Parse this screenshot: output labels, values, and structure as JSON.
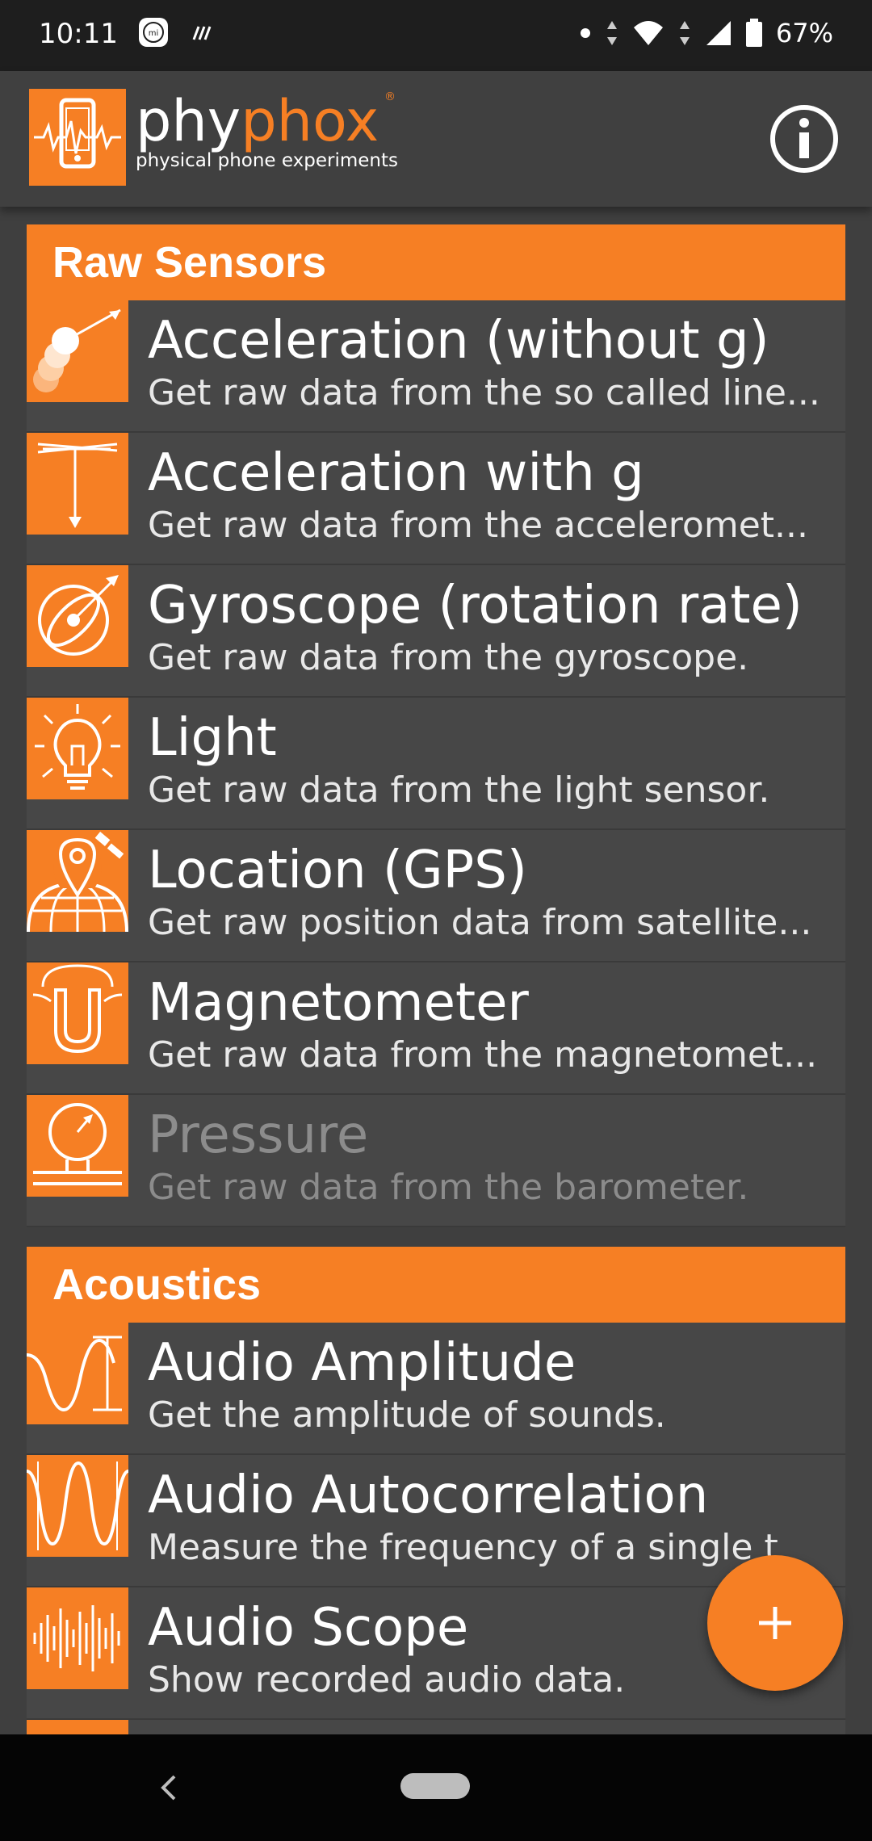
{
  "status_bar": {
    "time": "10:11",
    "battery_percent": "67%",
    "icons": [
      "mi-notification-icon",
      "signal-notification-icon",
      "dot-icon",
      "data-arrows-icon",
      "wifi-icon",
      "cell-signal-icon",
      "battery-icon"
    ]
  },
  "app_bar": {
    "brand_phy": "phy",
    "brand_phox": "phox",
    "brand_registered": "®",
    "tagline": "physical phone experiments",
    "info_icon": "info-icon"
  },
  "categories": [
    {
      "title": "Raw Sensors",
      "items": [
        {
          "title": "Acceleration (without g)",
          "desc": "Get raw data from the so called line...",
          "icon": "linear-acceleration-icon"
        },
        {
          "title": "Acceleration with g",
          "desc": "Get raw data from the acceleromet...",
          "icon": "acceleration-g-icon"
        },
        {
          "title": "Gyroscope (rotation rate)",
          "desc": "Get raw data from the gyroscope.",
          "icon": "gyroscope-icon"
        },
        {
          "title": "Light",
          "desc": "Get raw data from the light sensor.",
          "icon": "light-bulb-icon"
        },
        {
          "title": "Location (GPS)",
          "desc": "Get raw position data from satellite...",
          "icon": "gps-location-icon"
        },
        {
          "title": "Magnetometer",
          "desc": "Get raw data from the magnetomet...",
          "icon": "magnet-icon"
        },
        {
          "title": "Pressure",
          "desc": "Get raw data from the barometer.",
          "icon": "barometer-icon",
          "disabled": true
        }
      ]
    },
    {
      "title": "Acoustics",
      "items": [
        {
          "title": "Audio Amplitude",
          "desc": "Get the amplitude of sounds.",
          "icon": "audio-amplitude-icon"
        },
        {
          "title": "Audio Autocorrelation",
          "desc": "Measure the frequency of a single t",
          "icon": "audio-autocorrelation-icon"
        },
        {
          "title": "Audio Scope",
          "desc": "Show recorded audio data.",
          "icon": "audio-scope-icon"
        }
      ]
    }
  ],
  "fab": {
    "icon": "plus-icon",
    "label": "+"
  },
  "nav_bar": {
    "back_icon": "back-chevron-icon",
    "home_icon": "home-pill-icon"
  },
  "colors": {
    "accent": "#f67f24",
    "background": "#3f3f3f",
    "item_background": "#474747"
  }
}
